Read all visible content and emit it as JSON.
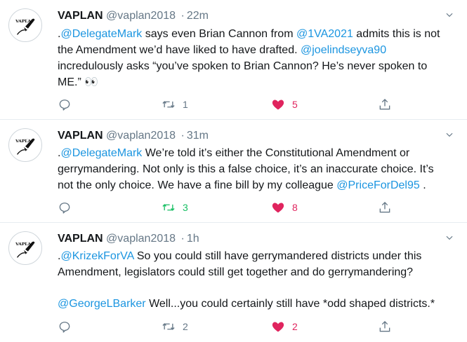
{
  "colors": {
    "link": "#1b95e0",
    "muted": "#657786",
    "retweeted": "#17bf63",
    "liked": "#e0245e",
    "divider": "#e6ecf0"
  },
  "tweets": [
    {
      "avatar_icon": "vaplan-pen-nib-logo",
      "name": "VAPLAN",
      "handle": "@vaplan2018",
      "separator": "·",
      "time": "22m",
      "segments": [
        {
          "text": ".",
          "type": "text"
        },
        {
          "text": "@DelegateMark",
          "type": "mention"
        },
        {
          "text": " says even Brian Cannon from ",
          "type": "text"
        },
        {
          "text": "@1VA2021",
          "type": "mention"
        },
        {
          "text": " admits this is not the Amendment we’d have liked to have drafted. ",
          "type": "text"
        },
        {
          "text": "@joelindseyva90",
          "type": "mention"
        },
        {
          "text": " incredulously asks “you’ve spoken to Brian Cannon? He’s never spoken to ME.” ",
          "type": "text"
        },
        {
          "text": "👀",
          "type": "emoji"
        }
      ],
      "reply_count": "",
      "retweet_count": "1",
      "like_count": "5",
      "retweeted": false,
      "liked": true
    },
    {
      "avatar_icon": "vaplan-pen-nib-logo",
      "name": "VAPLAN",
      "handle": "@vaplan2018",
      "separator": "·",
      "time": "31m",
      "segments": [
        {
          "text": ".",
          "type": "text"
        },
        {
          "text": "@DelegateMark",
          "type": "mention"
        },
        {
          "text": " We’re told it’s either the Constitutional Amendment or gerrymandering. Not only is this a false choice, it’s an inaccurate choice. It’s not the only choice. We have a fine bill by my colleague ",
          "type": "text"
        },
        {
          "text": "@PriceForDel95",
          "type": "mention"
        },
        {
          "text": " .",
          "type": "text"
        }
      ],
      "reply_count": "",
      "retweet_count": "3",
      "like_count": "8",
      "retweeted": true,
      "liked": true
    },
    {
      "avatar_icon": "vaplan-pen-nib-logo",
      "name": "VAPLAN",
      "handle": "@vaplan2018",
      "separator": "·",
      "time": "1h",
      "segments": [
        {
          "text": ".",
          "type": "text"
        },
        {
          "text": "@KrizekForVA",
          "type": "mention"
        },
        {
          "text": " So you could still have gerrymandered districts under this Amendment, legislators could still get together and do gerrymandering?",
          "type": "text"
        }
      ],
      "segments_2": [
        {
          "text": "@GeorgeLBarker",
          "type": "mention"
        },
        {
          "text": " Well...you could certainly still have *odd shaped districts.*",
          "type": "text"
        }
      ],
      "reply_count": "",
      "retweet_count": "2",
      "like_count": "2",
      "retweeted": false,
      "liked": true
    }
  ]
}
